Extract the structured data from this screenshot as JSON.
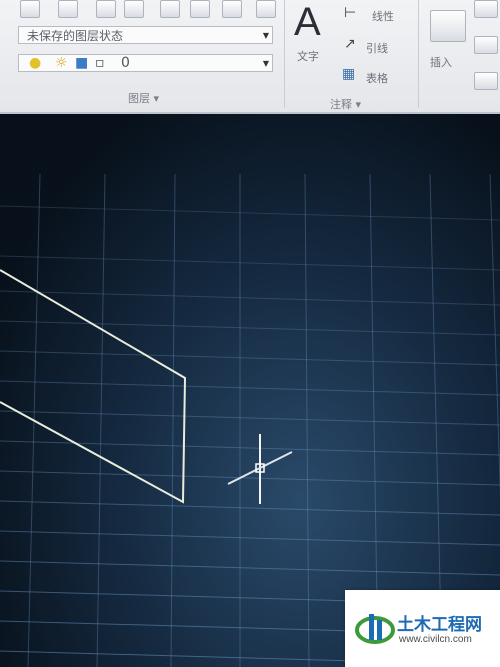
{
  "ribbon": {
    "layer_combo_value": "未保存的图层状态",
    "layer_panel_label": "图层",
    "annotation_panel_label": "注释",
    "text_label": "文字",
    "linear_label": "线性",
    "leader_label": "引线",
    "table_label": "表格",
    "insert_label": "插入",
    "panel_dropdown_glyph": "▾"
  },
  "status_bar": {
    "line1": "",
    "line2": ""
  },
  "watermark": {
    "title": "土木工程网",
    "url": "www.civilcn.com"
  },
  "colors": {
    "canvas": "#14283e",
    "grid": "#6f9cc9",
    "geometry": "#e9ecdc",
    "watermark_blue": "#1d6bb5"
  }
}
